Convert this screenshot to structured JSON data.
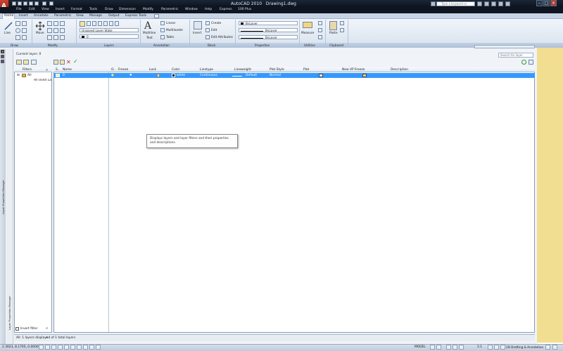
{
  "window": {
    "app_title": "AutoCAD 2010",
    "doc_title": "Drawing1.dwg",
    "search_placeholder": "Type a keyword or phrase"
  },
  "menus": [
    "File",
    "Edit",
    "View",
    "Insert",
    "Format",
    "Tools",
    "Draw",
    "Dimension",
    "Modify",
    "Parametric",
    "Window",
    "Help",
    "Express",
    "100 Plus"
  ],
  "tabs": [
    "Home",
    "Insert",
    "Annotate",
    "Parametric",
    "View",
    "Manage",
    "Output",
    "Express Tools"
  ],
  "ribbon": {
    "draw": {
      "line": "Line",
      "panel": "Draw"
    },
    "modify": {
      "move": "Move",
      "panel": "Modify"
    },
    "layers": {
      "state": "Unsaved Layer State",
      "current": "0",
      "panel": "Layers"
    },
    "annotation": {
      "mtext_1": "Multiline",
      "mtext_2": "Text",
      "linear": "Linear",
      "multileader": "Multileader",
      "table": "Table",
      "panel": "Annotation"
    },
    "block": {
      "insert": "Insert",
      "create": "Create",
      "edit": "Edit",
      "edit_attributes": "Edit Attributes",
      "panel": "Block"
    },
    "properties": {
      "color": "ByLayer",
      "linetype": "ByLayer",
      "lineweight": "ByLayer",
      "panel": "Properties"
    },
    "utilities": {
      "measure": "Measure",
      "panel": "Utilities"
    },
    "clipboard": {
      "paste": "Paste",
      "panel": "Clipboard"
    }
  },
  "lpm": {
    "current_layer": "Current layer: 0",
    "search_placeholder": "Search for layer",
    "side_title": "Layer Properties Manager",
    "filters_header": "Filters",
    "tree": [
      "All",
      "All Used Layers"
    ],
    "invert_filter": "Invert filter",
    "columns": [
      "S..",
      "Name",
      "O..",
      "Freeze",
      "Lock",
      "Color",
      "Linetype",
      "Lineweight",
      "Plot Style",
      "Plot",
      "New VP Freeze",
      "Description"
    ],
    "row": {
      "name": "0",
      "color": "white",
      "linetype": "Continuous",
      "lineweight": "Default",
      "plot_style": "Normal"
    },
    "tooltip": "Displays layers and layer filters and their properties and descriptions.",
    "status": "All: 1 layers displayed of 1 total layers"
  },
  "statusbar": {
    "coords": "2.3023, 8.1705, 0.0000",
    "model": "MODEL",
    "scale": "1:1",
    "workspace": "2D Drafting & Annotation"
  },
  "colors": {
    "accent": "#3399ff",
    "titlebar": "#1c2636",
    "yellow_panel": "#f2de90"
  }
}
